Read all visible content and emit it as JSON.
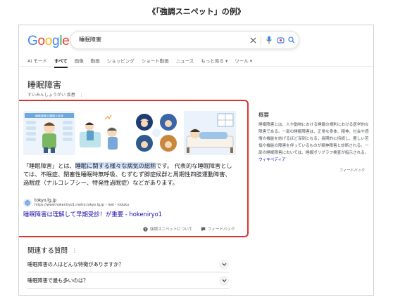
{
  "caption": "《「強調スニペット」の例》",
  "logo": {
    "letters": [
      "G",
      "o",
      "o",
      "g",
      "l",
      "e"
    ],
    "colors": [
      "#4285F4",
      "#EA4335",
      "#FBBC05",
      "#4285F4",
      "#34A853",
      "#EA4335"
    ]
  },
  "search": {
    "query": "睡眠障害"
  },
  "tabs": [
    "AI モード",
    "すべて",
    "画像",
    "動画",
    "ショッピング",
    "ショート動画",
    "ニュース",
    "もっと見る ▾",
    "ツール ▾"
  ],
  "entity": {
    "title": "睡眠障害",
    "subtitle": "すいみんしょうがい  疾患",
    "menu": "⋮"
  },
  "snippet": {
    "text_pre": "「睡眠障害」とは、",
    "text_highlight": "睡眠に関する様々な病気の総称",
    "text_post": "です。 代表的な睡眠障害としては、不眠症、閉塞性睡眠時無呼吸、むずむず脚症候群と周期性四肢運動障害、過眠症（ナルコレプシー、特発性過眠症）などがあります。",
    "source_site": "tokyo.lg.jp",
    "source_url": "https://www.hokeniryo1.metro.tokyo.lg.jp › rest › kiduku",
    "source_title": "睡眠障害は理解して早期受診！が重要 - hokeniryo1",
    "about_label": "強調スニペットについて",
    "feedback_label": "フィードバック",
    "image1_heading": "睡眠障害の種類と症状"
  },
  "knowledge_panel": {
    "title": "概要",
    "text": "睡眠障害とは、人や動物における睡眠の規則における医学的な障害である。一部の睡眠障害は、正常な身体、精神、社会や感情の機能を妨げるほど深刻となる。長期的に持続し、著しい苦悩や機能の障害を伴っているものが精神障害と診断される。一部の睡眠障害においては、睡眠ポリグラフ検査が指示される。",
    "link": "ウィキペディア",
    "feedback": "フィードバック"
  },
  "paa": {
    "title": "関連する質問",
    "menu": "⋮",
    "items": [
      "睡眠障害の人はどんな特徴がありますか？",
      "睡眠障害で最も多いのは？"
    ]
  },
  "colors": {
    "highlight": "#d3e3fd",
    "link": "#1a0dab",
    "frame": "#e0332b"
  }
}
